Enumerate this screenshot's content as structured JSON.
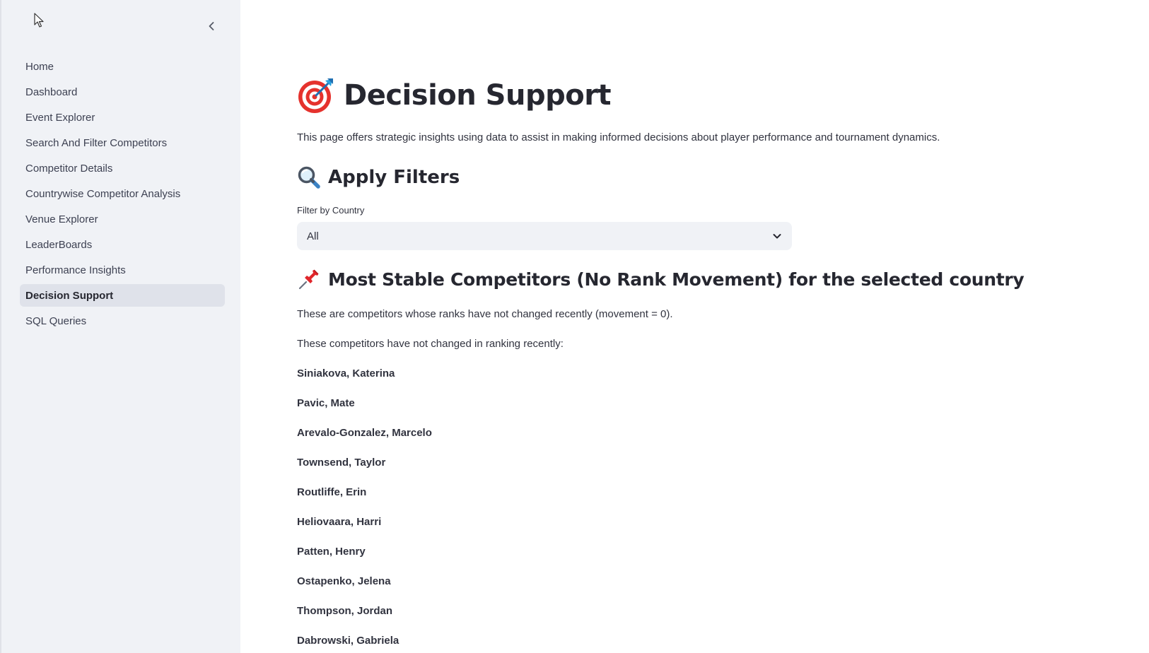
{
  "sidebar": {
    "items": [
      {
        "label": "Home",
        "active": false
      },
      {
        "label": "Dashboard",
        "active": false
      },
      {
        "label": "Event Explorer",
        "active": false
      },
      {
        "label": "Search And Filter Competitors",
        "active": false
      },
      {
        "label": "Competitor Details",
        "active": false
      },
      {
        "label": "Countrywise Competitor Analysis",
        "active": false
      },
      {
        "label": "Venue Explorer",
        "active": false
      },
      {
        "label": "LeaderBoards",
        "active": false
      },
      {
        "label": "Performance Insights",
        "active": false
      },
      {
        "label": "Decision Support",
        "active": true
      },
      {
        "label": "SQL Queries",
        "active": false
      }
    ]
  },
  "main": {
    "title": "Decision Support",
    "title_icon": "target-icon",
    "intro": "This page offers strategic insights using data to assist in making informed decisions about player performance and tournament dynamics.",
    "filters": {
      "heading": "Apply Filters",
      "heading_icon": "magnifier-icon",
      "label": "Filter by Country",
      "selected": "All"
    },
    "stable": {
      "heading": "Most Stable Competitors (No Rank Movement) for the selected country",
      "heading_icon": "pushpin-icon",
      "description": "These are competitors whose ranks have not changed recently (movement = 0).",
      "subheading": "These competitors have not changed in ranking recently:",
      "competitors": [
        "Siniakova, Katerina",
        "Pavic, Mate",
        "Arevalo-Gonzalez, Marcelo",
        "Townsend, Taylor",
        "Routliffe, Erin",
        "Heliovaara, Harri",
        "Patten, Henry",
        "Ostapenko, Jelena",
        "Thompson, Jordan",
        "Dabrowski, Gabriela"
      ]
    }
  },
  "colors": {
    "sidebar_bg": "#f0f2f6",
    "active_item_bg": "#dfe2ea",
    "text": "#31333f",
    "target_red": "#e5322d",
    "dart_blue": "#29a3e0",
    "pin_red": "#e0262b"
  }
}
